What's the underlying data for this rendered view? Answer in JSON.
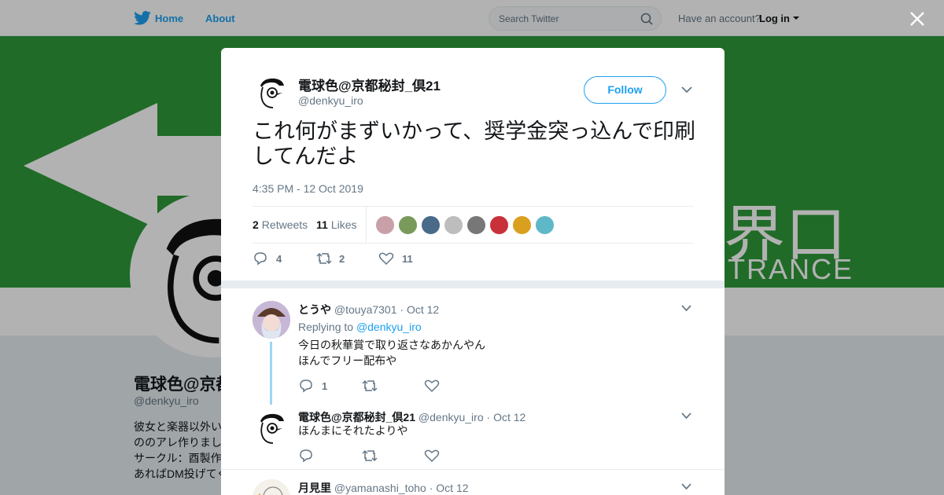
{
  "nav": {
    "home": "Home",
    "about": "About",
    "search_placeholder": "Search Twitter",
    "have_account": "Have an account?",
    "login": "Log in"
  },
  "banner": {
    "kanji": "界口",
    "english": "TRANCE"
  },
  "profile": {
    "name": "電球色@京都",
    "handle": "@denkyu_iro",
    "bio_lines": [
      "彼女と楽器以外い",
      "ののアレ作りまし",
      "サークル：酉製作",
      "あればDM投げてく"
    ]
  },
  "tweet": {
    "author_name": "電球色@京都秘封_倶21",
    "author_handle": "@denkyu_iro",
    "follow_label": "Follow",
    "text": "これ何がまずいかって、奨学金突っ込んで印刷してんだよ",
    "timestamp": "4:35 PM - 12 Oct 2019",
    "retweets_count": "2",
    "retweets_label": "Retweets",
    "likes_count": "11",
    "likes_label": "Likes",
    "liker_colors": [
      "#c9a0a8",
      "#7a9a5c",
      "#4a6a8a",
      "#bdbdbd",
      "#777777",
      "#c8303a",
      "#d9a020",
      "#5fb8c8"
    ],
    "reply_count": "4",
    "retweet_count": "2",
    "like_count": "11"
  },
  "replies": [
    {
      "name": "とうや",
      "handle": "@touya7301",
      "date": "Oct 12",
      "replying_prefix": "Replying to",
      "replying_to": "@denkyu_iro",
      "lines": [
        "今日の秋華賞で取り返さなあかんやん",
        "ほんでフリー配布や"
      ],
      "reply_count": "1"
    },
    {
      "name": "電球色@京都秘封_倶21",
      "handle": "@denkyu_iro",
      "date": "Oct 12",
      "lines": [
        "ほんまにそれたよりや"
      ],
      "reply_count": ""
    },
    {
      "name": "月見里",
      "handle": "@yamanashi_toho",
      "date": "Oct 12"
    }
  ],
  "colors": {
    "accent": "#1da1f2",
    "banner_green": "#2e9a3a"
  }
}
